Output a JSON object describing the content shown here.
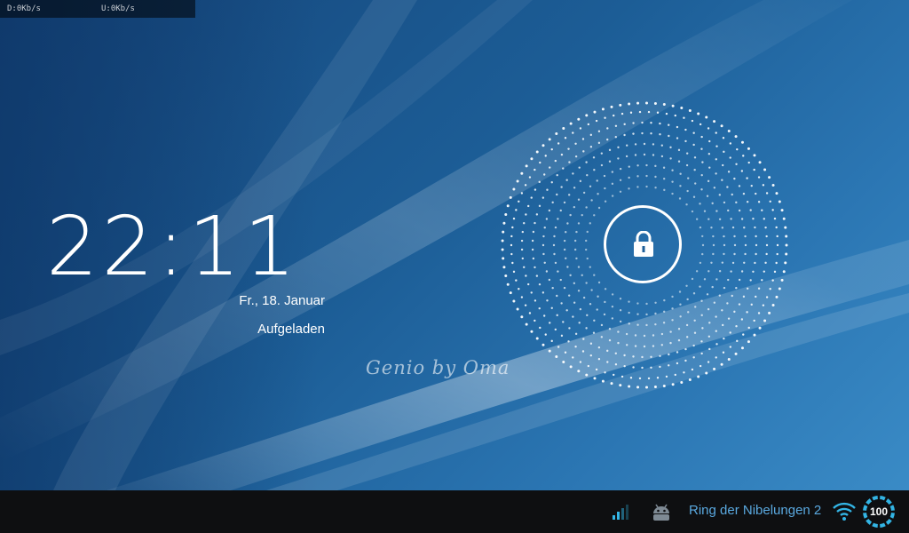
{
  "net_monitor": {
    "download": "D:0Kb/s",
    "upload": "U:0Kb/s"
  },
  "lockscreen": {
    "time": "22:11",
    "date": "Fr., 18. Januar",
    "charge_status": "Aufgeladen",
    "owner_info": "Genio by Oma",
    "unlock_icon": "lock-icon"
  },
  "status_bar": {
    "signal_icon": "signal-bars-icon",
    "notification_icon": "android-icon",
    "wifi_network": "Ring der Nibelungen 2",
    "wifi_icon": "wifi-icon",
    "battery_level": "100",
    "battery_fraction": 1.0
  },
  "colors": {
    "accent": "#33b5e5",
    "ssid_text": "#5aa9e0",
    "navbar_bg": "#0e0f11"
  }
}
